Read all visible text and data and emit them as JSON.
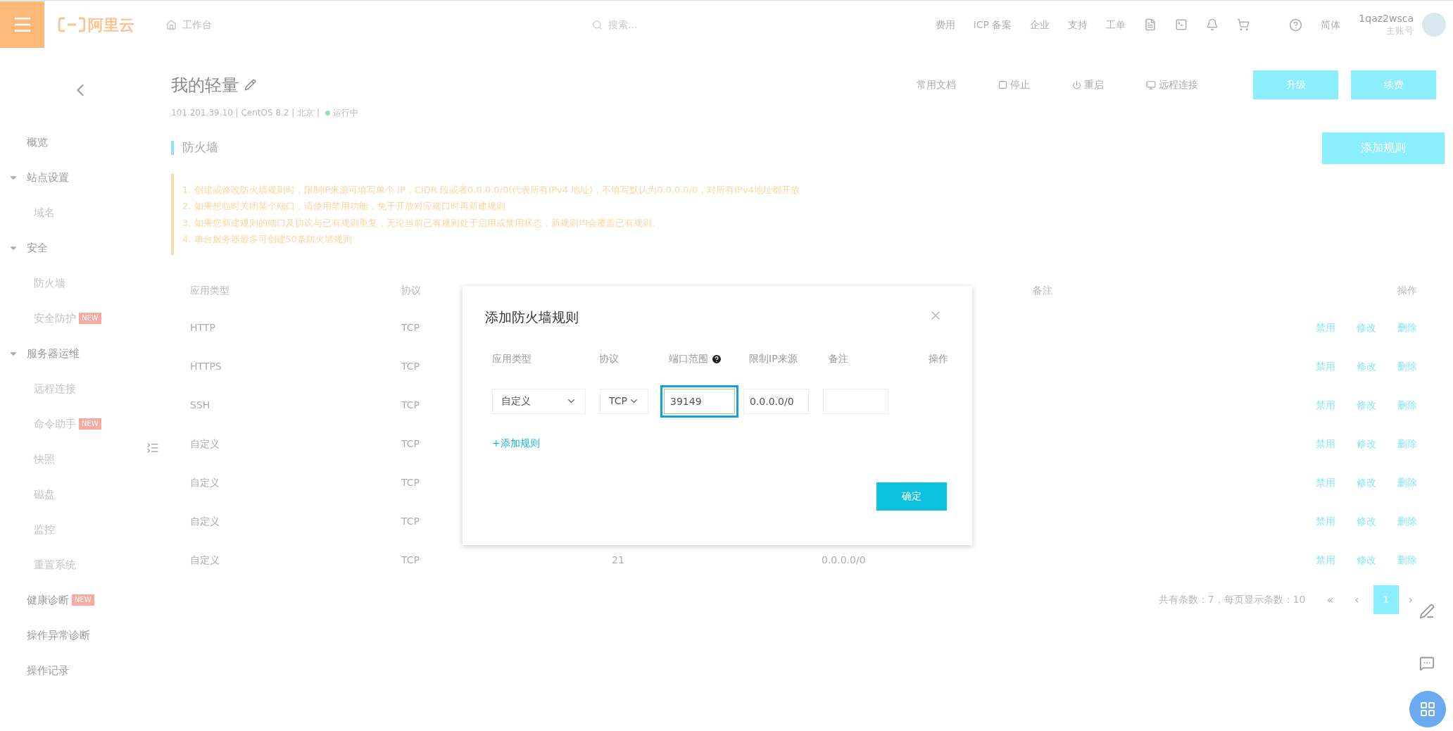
{
  "topbar": {
    "logo": "阿里云",
    "home": "工作台",
    "search": {
      "placeholder": "搜索..."
    },
    "links": [
      "费用",
      "ICP 备案",
      "企业",
      "支持",
      "工单"
    ],
    "language": "简体",
    "user": {
      "name": "1qaz2wsca",
      "role": "主账号"
    }
  },
  "sidebar": {
    "items": [
      {
        "label": "概览"
      },
      {
        "label": "站点设置",
        "expanded": true,
        "children": [
          {
            "label": "域名"
          }
        ]
      },
      {
        "label": "安全",
        "expanded": true,
        "children": [
          {
            "label": "防火墙"
          },
          {
            "label": "安全防护",
            "badge": "NEW"
          }
        ]
      },
      {
        "label": "服务器运维",
        "expanded": true,
        "children": [
          {
            "label": "远程连接"
          },
          {
            "label": "命令助手",
            "badge": "NEW"
          },
          {
            "label": "快照"
          },
          {
            "label": "磁盘"
          },
          {
            "label": "监控"
          },
          {
            "label": "重置系统"
          }
        ]
      },
      {
        "label": "健康诊断",
        "badge": "NEW"
      },
      {
        "label": "操作异常诊断"
      },
      {
        "label": "操作记录"
      }
    ]
  },
  "header": {
    "title": "我的轻量",
    "info": "101.201.39.10 | CentOS 8.2 | 北京 |",
    "status": "运行中",
    "actions": [
      {
        "label": "常用文档",
        "kind": "link"
      },
      {
        "label": "停止",
        "kind": "stop"
      },
      {
        "label": "重启",
        "kind": "restart"
      },
      {
        "label": "远程连接",
        "kind": "remote"
      },
      {
        "label": "升级",
        "kind": "primary"
      },
      {
        "label": "续费",
        "kind": "primary"
      }
    ]
  },
  "firewall": {
    "title": "防火墙",
    "add_button": "添加规则",
    "notes": [
      "1. 创建或修改防火墙规则时，限制IP来源可填写单个 IP，CIDR 段或者0.0.0.0/0(代表所有IPv4 地址)，不填写默认为0.0.0.0/0，对所有IPv4地址都开放",
      "2. 如果想临时关闭某个端口，请使用禁用功能，免于开放对应端口时再新建规则",
      "3. 如果您新建规则的端口及协议与已有规则重复，无论当前已有规则处于启用或禁用状态，新规则均会覆盖已有规则。",
      "4. 单台服务器最多可创建50条防火墙规则"
    ],
    "table": {
      "header": [
        {
          "kind": "type",
          "label": "应用类型"
        },
        {
          "kind": "protocol",
          "label": "协议"
        },
        {
          "kind": "note",
          "label": "备注"
        },
        {
          "kind": "actions",
          "label": "操作"
        }
      ],
      "rows": [
        {
          "type": "HTTP",
          "protocol": "TCP",
          "actions": [
            "禁用",
            "修改",
            "删除"
          ]
        },
        {
          "type": "HTTPS",
          "protocol": "TCP",
          "actions": [
            "禁用",
            "修改",
            "删除"
          ]
        },
        {
          "type": "SSH",
          "protocol": "TCP",
          "actions": [
            "禁用",
            "修改",
            "删除"
          ]
        },
        {
          "type": "自定义",
          "protocol": "TCP",
          "actions": [
            "禁用",
            "修改",
            "删除"
          ]
        },
        {
          "type": "自定义",
          "protocol": "TCP",
          "actions": [
            "禁用",
            "修改",
            "删除"
          ]
        },
        {
          "type": "自定义",
          "protocol": "TCP",
          "actions": [
            "禁用",
            "修改",
            "删除"
          ]
        },
        {
          "type": "自定义",
          "protocol": "TCP",
          "port": "21",
          "source": "0.0.0.0/0",
          "actions": [
            "禁用",
            "修改",
            "删除"
          ]
        }
      ]
    },
    "pagination": {
      "summary": "共有条数：7，每页显示条数：10",
      "first": "«",
      "prev": "‹",
      "pages": [
        {
          "label": "1",
          "selected": true
        }
      ],
      "next": "›"
    }
  },
  "dialog": {
    "title": "添加防火墙规则",
    "columns": [
      {
        "label": "应用类型"
      },
      {
        "label": "协议"
      },
      {
        "label": "端口范围",
        "help": true
      },
      {
        "label": "限制IP来源"
      },
      {
        "label": "备注"
      },
      {
        "label": "操作"
      }
    ],
    "row": {
      "type": "自定义",
      "protocol": "TCP",
      "port": {
        "value": "39149",
        "focused": true
      },
      "source": "0.0.0.0/0"
    },
    "add_rule": "+添加规则",
    "confirm": "确定"
  }
}
